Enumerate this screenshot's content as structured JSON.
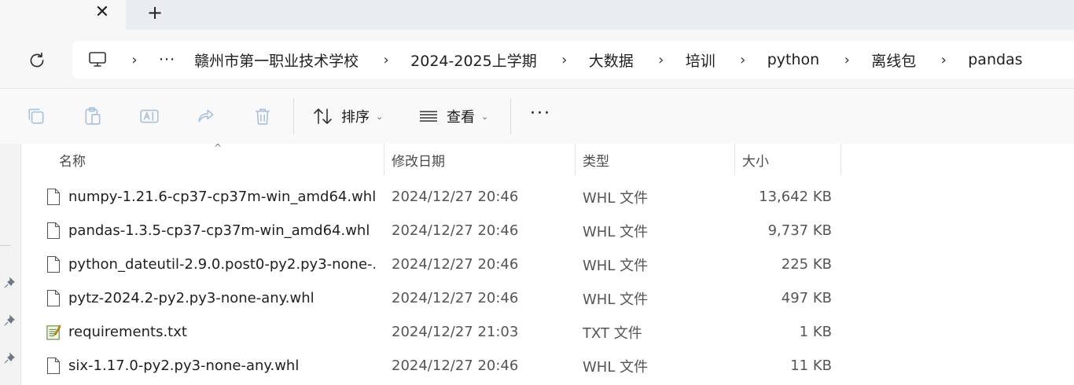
{
  "tabs": {
    "close_glyph": "✕",
    "new_glyph": "+"
  },
  "breadcrumb": {
    "overflow": "···",
    "items": [
      "赣州市第一职业技术学校",
      "2024-2025上学期",
      "大数据",
      "培训",
      "python",
      "离线包",
      "pandas"
    ]
  },
  "toolbar": {
    "sort_label": "排序",
    "view_label": "查看",
    "more_label": "···",
    "icons": [
      "copy-icon",
      "paste-icon",
      "rename-icon",
      "share-icon",
      "delete-icon"
    ]
  },
  "columns": {
    "name": "名称",
    "date": "修改日期",
    "type": "类型",
    "size": "大小"
  },
  "files": [
    {
      "name": "numpy-1.21.6-cp37-cp37m-win_amd64.whl",
      "date": "2024/12/27 20:46",
      "type": "WHL 文件",
      "size": "13,642 KB",
      "icon": "file-icon"
    },
    {
      "name": "pandas-1.3.5-cp37-cp37m-win_amd64.whl",
      "date": "2024/12/27 20:46",
      "type": "WHL 文件",
      "size": "9,737 KB",
      "icon": "file-icon"
    },
    {
      "name": "python_dateutil-2.9.0.post0-py2.py3-none-...",
      "date": "2024/12/27 20:46",
      "type": "WHL 文件",
      "size": "225 KB",
      "icon": "file-icon"
    },
    {
      "name": "pytz-2024.2-py2.py3-none-any.whl",
      "date": "2024/12/27 20:46",
      "type": "WHL 文件",
      "size": "497 KB",
      "icon": "file-icon"
    },
    {
      "name": "requirements.txt",
      "date": "2024/12/27 21:03",
      "type": "TXT 文件",
      "size": "1 KB",
      "icon": "text-file-icon"
    },
    {
      "name": "six-1.17.0-py2.py3-none-any.whl",
      "date": "2024/12/27 20:46",
      "type": "WHL 文件",
      "size": "11 KB",
      "icon": "file-icon"
    }
  ],
  "colors": {
    "accent": "#0067c0",
    "toolbar_disabled": "#a9c2d9"
  }
}
